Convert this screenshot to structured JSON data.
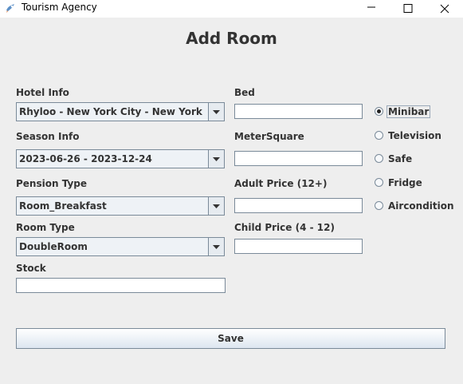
{
  "window": {
    "title": "Tourism Agency"
  },
  "heading": "Add Room",
  "hotel_info": {
    "label": "Hotel Info",
    "value": "Rhyloo - New York City - New York"
  },
  "season_info": {
    "label": "Season Info",
    "value": "2023-06-26 - 2023-12-24"
  },
  "pension_type": {
    "label": "Pension Type",
    "value": "Room_Breakfast"
  },
  "room_type": {
    "label": "Room Type",
    "value": "DoubleRoom"
  },
  "stock": {
    "label": "Stock",
    "value": ""
  },
  "bed": {
    "label": "Bed",
    "value": ""
  },
  "meter_square": {
    "label": "MeterSquare",
    "value": ""
  },
  "adult_price": {
    "label": "Adult Price (12+)",
    "value": ""
  },
  "child_price": {
    "label": "Child Price (4 - 12)",
    "value": ""
  },
  "features": [
    {
      "label": "Minibar",
      "selected": true
    },
    {
      "label": "Television",
      "selected": false
    },
    {
      "label": "Safe",
      "selected": false
    },
    {
      "label": "Fridge",
      "selected": false
    },
    {
      "label": "Aircondition",
      "selected": false
    }
  ],
  "save_label": "Save"
}
